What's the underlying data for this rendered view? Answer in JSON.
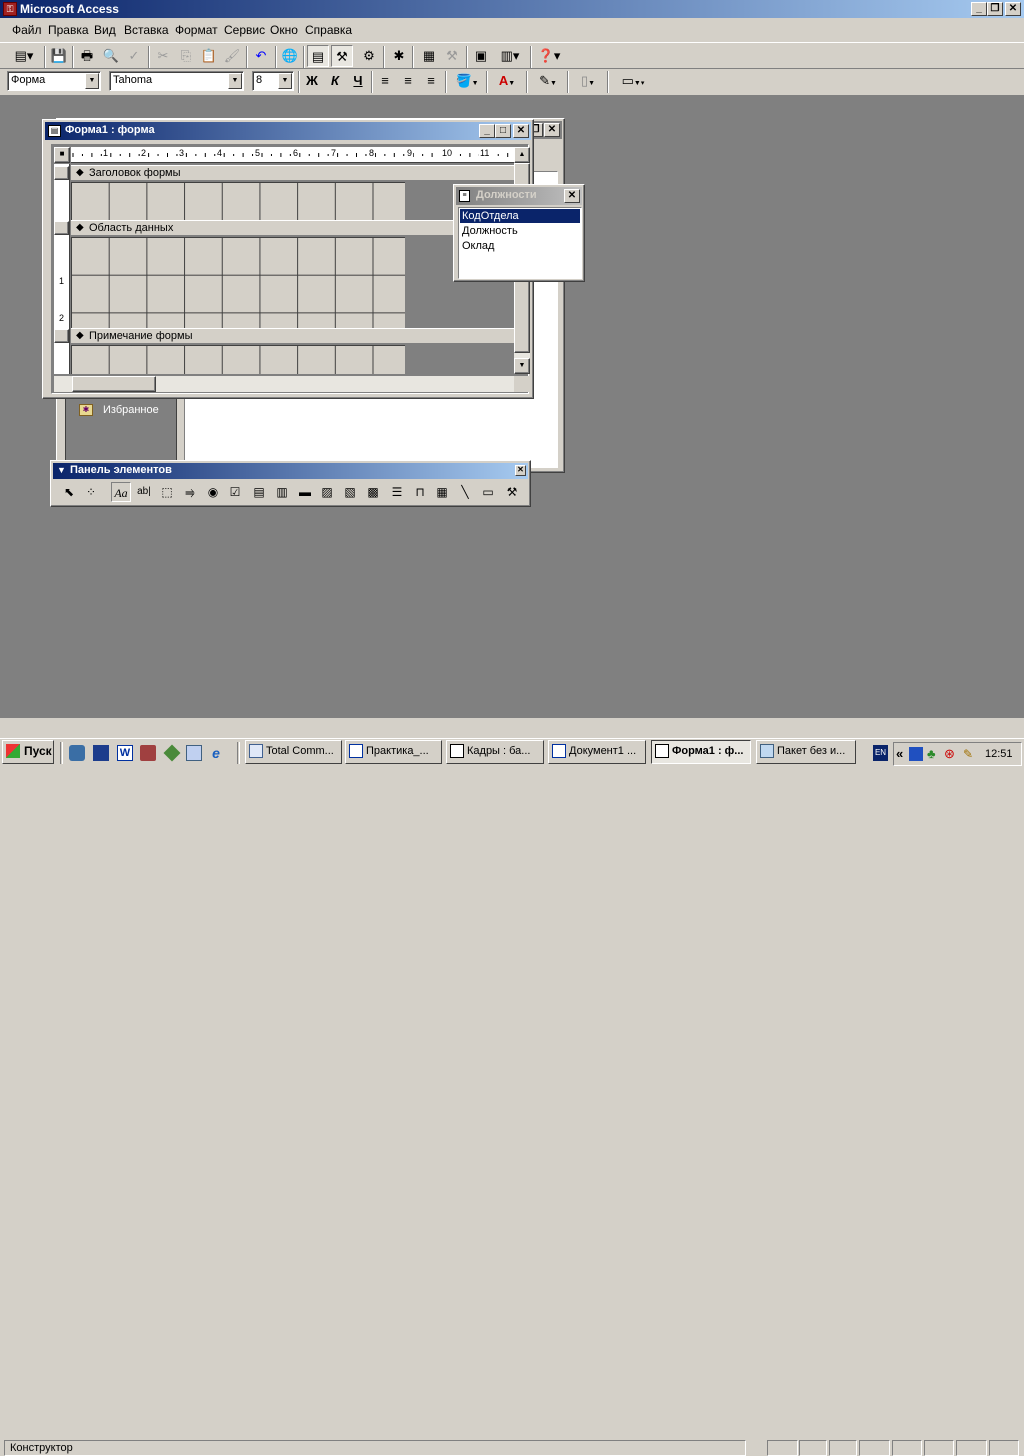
{
  "app": {
    "title": "Microsoft Access",
    "menu": [
      "Файл",
      "Правка",
      "Вид",
      "Вставка",
      "Формат",
      "Сервис",
      "Окно",
      "Справка"
    ]
  },
  "format_bar": {
    "object": "Форма",
    "font": "Tahoma",
    "size": "8",
    "bold": "Ж",
    "italic": "К",
    "underline": "Ч"
  },
  "form_window": {
    "title": "Форма1 : форма",
    "ruler": [
      "1",
      "2",
      "3",
      "4",
      "5",
      "6",
      "7",
      "8",
      "9",
      "10",
      "11"
    ],
    "vruler": [
      "1",
      "2"
    ],
    "sections": [
      "Заголовок формы",
      "Область данных",
      "Примечание формы"
    ]
  },
  "field_list": {
    "title": "Должности",
    "items": [
      "КодОтдела",
      "Должность",
      "Оклад"
    ],
    "selected_index": 0
  },
  "db_window": {
    "favorites": "Избранное"
  },
  "toolbox": {
    "title": "Панель элементов",
    "icons": [
      "select-objects-icon",
      "control-wizards-icon",
      "label-icon",
      "textbox-icon",
      "option-group-icon",
      "toggle-button-icon",
      "option-button-icon",
      "checkbox-icon",
      "combo-box-icon",
      "list-box-icon",
      "command-button-icon",
      "image-icon",
      "unbound-object-frame-icon",
      "bound-object-frame-icon",
      "page-break-icon",
      "tab-control-icon",
      "subform-icon",
      "line-icon",
      "rectangle-icon",
      "more-controls-icon"
    ]
  },
  "status": {
    "text": "Конструктор"
  },
  "taskbar": {
    "start": "Пуск",
    "tasks": [
      {
        "label": "Total Comm...",
        "active": false
      },
      {
        "label": "Практика_...",
        "active": false
      },
      {
        "label": "Кадры : ба...",
        "active": false
      },
      {
        "label": "Документ1 ...",
        "active": false
      },
      {
        "label": "Форма1 : ф...",
        "active": true
      },
      {
        "label": "Пакет без и...",
        "active": false
      }
    ],
    "lang": "EN",
    "tray_chevron": "«",
    "clock": "12:51"
  },
  "colors": {
    "titlebar_active": "#0a246a",
    "titlebar_active_end": "#a6caf0",
    "titlebar_inactive": "#808080",
    "workspace": "#808080",
    "face": "#d4d0c8",
    "selection": "#0a246a"
  }
}
